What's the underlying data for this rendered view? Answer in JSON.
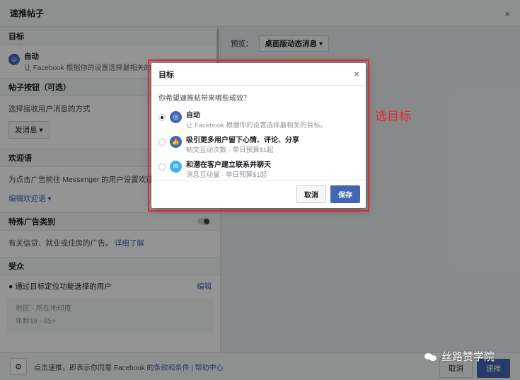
{
  "base": {
    "title": "速推帖子",
    "close": "×",
    "sections": {
      "objective_head": "目标",
      "objective_title": "自动",
      "objective_desc": "让 Facebook 根据你的设置选择最相关的目标。",
      "button_head": "帖子按钮（可选）",
      "button_label": "选择接收用户消息的方式",
      "button_select": "发消息 ▾",
      "welcome_head": "欢迎语",
      "welcome_text": "为点击广告前往 Messenger 的用户设置欢迎语",
      "welcome_edit": "编辑欢迎语 ▾",
      "special_head": "特殊广告类别",
      "special_text": "有关信贷、就业或住房的广告。",
      "special_link": "详细了解",
      "audience_head": "受众",
      "audience_option": "通过目标定位功能选择的用户",
      "audience_edit": "编辑",
      "audience_location": "地区 - 所在地印度",
      "audience_age": "年龄18 - 65+"
    },
    "preview": {
      "label": "预览：",
      "select": "桌面版动态消息 ▾"
    },
    "footer": {
      "text_prefix": "点击速推，即表示你同意 Facebook 的",
      "terms_link": "条款和条件",
      "separator": " | ",
      "help_link": "帮助中心",
      "cancel": "取消",
      "boost": "速推"
    }
  },
  "modal": {
    "title": "目标",
    "close": "×",
    "question": "你希望速推帖带来哪些成效？",
    "options": [
      {
        "title": "自动",
        "desc": "让 Facebook 根据你的设置选择最相关的目标。",
        "icon": "target-icon",
        "color": "#4267b2",
        "checked": true
      },
      {
        "title": "吸引更多用户留下心情、评论、分享",
        "desc": "帖文互动次数 · 单日预算$1起",
        "icon": "thumbs-up-icon",
        "color": "#4267b2",
        "checked": false
      },
      {
        "title": "和潜在客户建立联系并聊天",
        "desc": "消息互动量 · 单日预算$1起",
        "icon": "messenger-icon",
        "color": "#3ab5f0",
        "checked": false
      }
    ],
    "cancel": "取消",
    "save": "保存"
  },
  "annotation": "选目标",
  "watermark": "丝路赞学院",
  "colors": {
    "accent": "#4267b2",
    "annotation": "#e02a2a"
  }
}
